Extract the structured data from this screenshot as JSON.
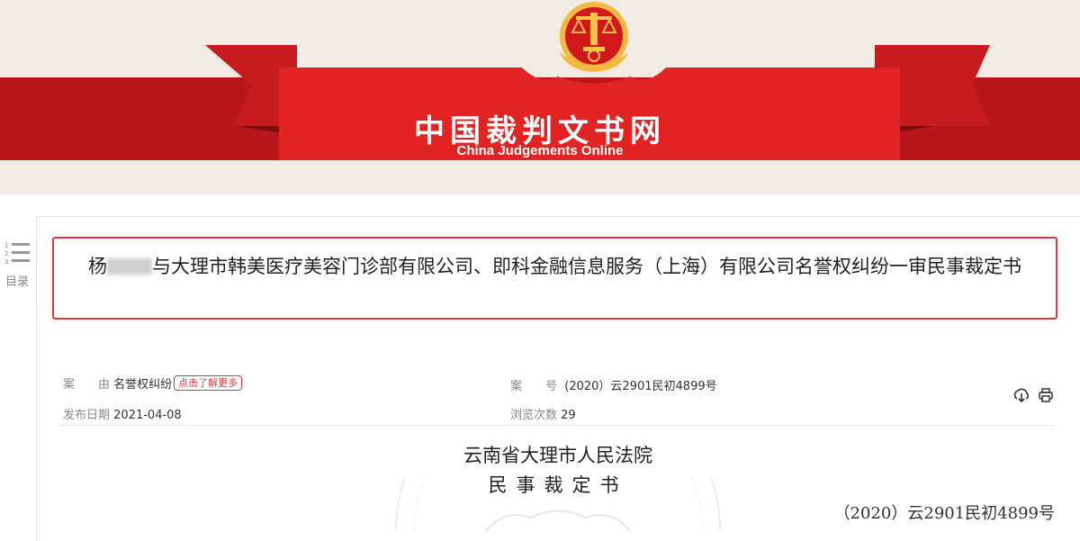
{
  "header": {
    "site_name": "中国裁判文书网",
    "site_name_en": "China Judgements Online",
    "emblem_icon": "court-scales-emblem",
    "colors": {
      "banner_red": "#c2191c",
      "bright_red": "#e42121",
      "gold": "#f6c24a",
      "background": "#f2ece4"
    }
  },
  "toc": {
    "label": "目录",
    "icon": "list-icon"
  },
  "document": {
    "title_prefix": "杨",
    "title_rest": "与大理市韩美医疗美容门诊部有限公司、即科金融信息服务（上海）有限公司名誉权纠纷一审民事裁定书",
    "meta": {
      "cause_label": "案　　由",
      "cause_value": "名誉权纠纷",
      "more_button": "点击了解更多",
      "case_no_label": "案　　号",
      "case_no_value": "(2020）云2901民初4899号",
      "publish_date_label": "发布日期",
      "publish_date_value": "2021-04-08",
      "views_label": "浏览次数",
      "views_value": "29"
    },
    "tools": {
      "download_icon": "download-icon",
      "print_icon": "print-icon"
    },
    "court_name": "云南省大理市人民法院",
    "doc_type": "民事裁定书",
    "case_number": "（2020）云2901民初4899号"
  }
}
